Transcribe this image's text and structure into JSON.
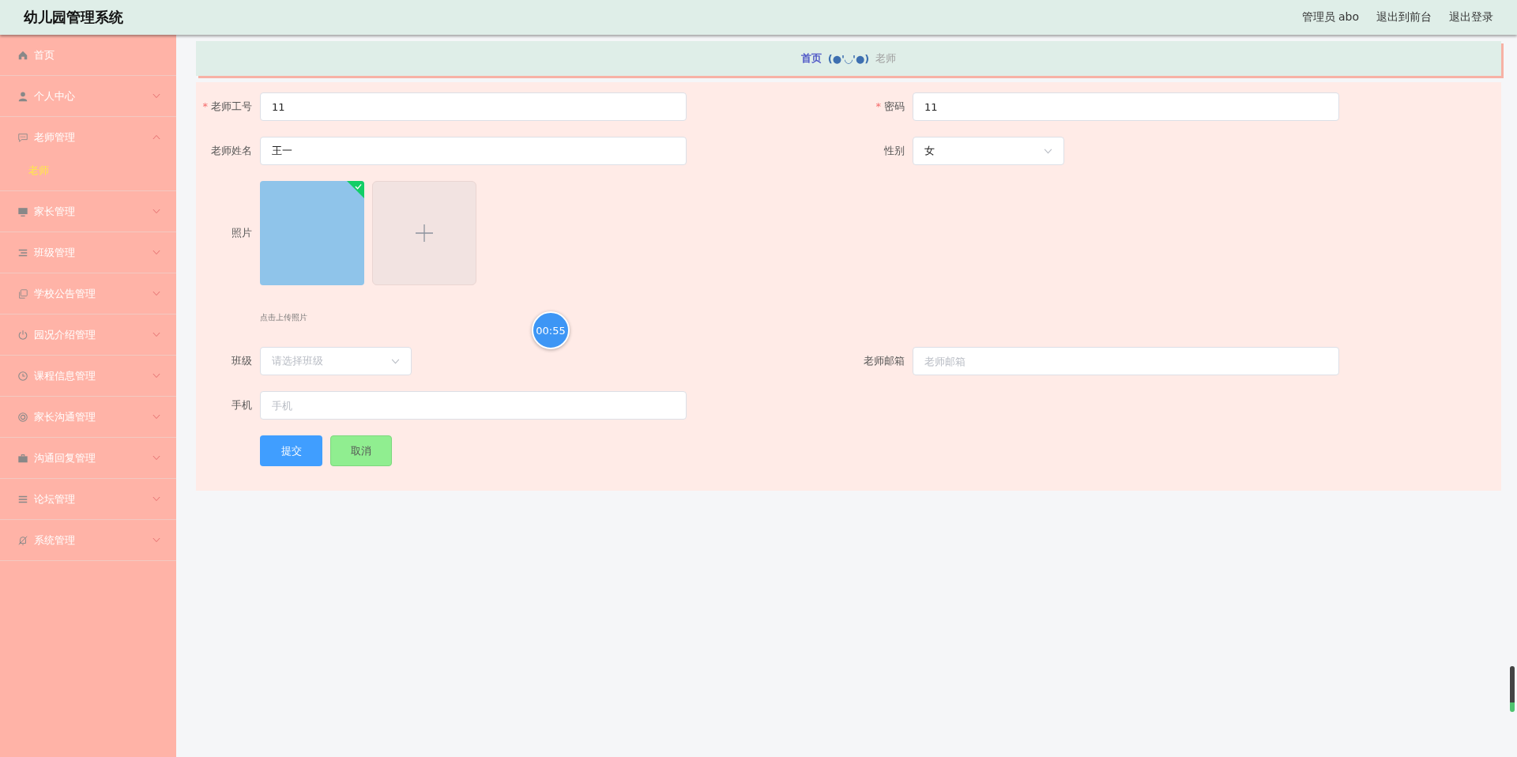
{
  "header": {
    "title": "幼儿园管理系统",
    "links": [
      "管理员 abo",
      "退出到前台",
      "退出登录"
    ]
  },
  "sidebar": {
    "items": [
      {
        "label": "首页",
        "kind": "link"
      },
      {
        "label": "个人中心",
        "kind": "group",
        "expanded": false
      },
      {
        "label": "老师管理",
        "kind": "group",
        "expanded": true,
        "children": [
          {
            "label": "老师",
            "selected": true
          }
        ]
      },
      {
        "label": "家长管理",
        "kind": "group",
        "expanded": false
      },
      {
        "label": "班级管理",
        "kind": "group",
        "expanded": false
      },
      {
        "label": "学校公告管理",
        "kind": "group",
        "expanded": false
      },
      {
        "label": "园况介绍管理",
        "kind": "group",
        "expanded": false
      },
      {
        "label": "课程信息管理",
        "kind": "group",
        "expanded": false
      },
      {
        "label": "家长沟通管理",
        "kind": "group",
        "expanded": false
      },
      {
        "label": "沟通回复管理",
        "kind": "group",
        "expanded": false
      },
      {
        "label": "论坛管理",
        "kind": "group",
        "expanded": false
      },
      {
        "label": "系统管理",
        "kind": "group",
        "expanded": false
      }
    ]
  },
  "breadcrumb": {
    "home": "首页",
    "separator": "(●'◡'●)",
    "current": "老师"
  },
  "form": {
    "rows": [
      [
        {
          "label": "老师工号",
          "kind": "text",
          "required_mark": "*",
          "value": "11"
        },
        {
          "label": "密码",
          "kind": "text",
          "required_mark": "*",
          "value": "11"
        }
      ],
      [
        {
          "label": "老师姓名",
          "kind": "text",
          "value": "王一"
        },
        {
          "label": "性别",
          "kind": "select",
          "value": "女"
        }
      ],
      [
        {
          "label": "照片",
          "kind": "upload",
          "uploaded": true,
          "hint": "点击上传照片"
        }
      ],
      [
        {
          "label": "班级",
          "kind": "select",
          "placeholder": "请选择班级"
        },
        {
          "label": "老师邮箱",
          "kind": "text",
          "placeholder": "老师邮箱"
        }
      ],
      [
        {
          "label": "手机",
          "kind": "text",
          "placeholder": "手机"
        }
      ]
    ],
    "buttons": [
      {
        "label": "提交",
        "kind": "primary"
      },
      {
        "label": "取消",
        "kind": "cancel"
      }
    ]
  },
  "timer_badge": "00:55"
}
